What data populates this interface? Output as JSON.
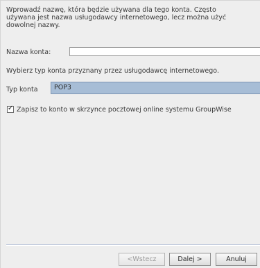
{
  "intro": {
    "text": "Wprowadź nazwę, która będzie używana dla tego konta. Często\nużywana jest nazwa usługodawcy internetowego, lecz można użyć\ndowolnej nazwy."
  },
  "account_name": {
    "label": "Nazwa konta:",
    "value": ""
  },
  "choose_text": "Wybierz typ konta przyznany przez usługodawcę internetowego.",
  "account_type": {
    "label": "Typ konta",
    "selected": "POP3"
  },
  "save_online": {
    "label": "Zapisz to konto w skrzynce pocztowej online systemu GroupWise",
    "checked": true
  },
  "buttons": {
    "back": "<Wstecz",
    "next": "Dalej >",
    "cancel": "Anuluj"
  },
  "colors": {
    "combo_selected_bg": "#a7bdd6",
    "panel_bg": "#eeeeee",
    "separator": "#a9b7d3"
  }
}
